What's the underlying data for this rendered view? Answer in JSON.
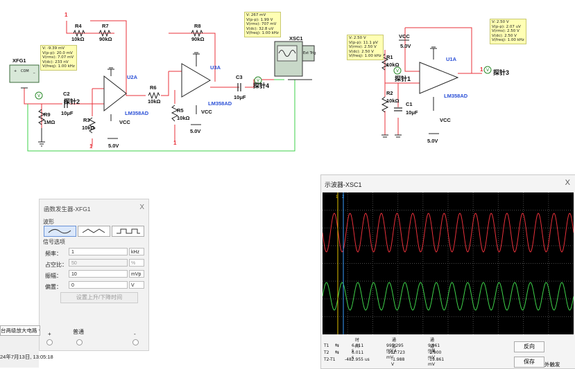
{
  "schematic": {
    "xfg1": "XFG1",
    "xsc1": "XSC1",
    "ext_trig": "Ext Trig",
    "plus": "+",
    "minus": "_",
    "com": "COM",
    "parts": {
      "r4": "R4",
      "r4v": "10kΩ",
      "r7": "R7",
      "r7v": "90kΩ",
      "r8": "R8",
      "r8v": "90kΩ",
      "r6": "R6",
      "r6v": "10kΩ",
      "r3": "R3",
      "r3v": "10kΩ",
      "r5": "R5",
      "r5v": "10kΩ",
      "r9": "R9",
      "r9v": "1MΩ",
      "r1": "R1",
      "r1v": "10kΩ",
      "r2": "R2",
      "r2v": "10kΩ",
      "c1": "C1",
      "c1v": "10μF",
      "c2": "C2",
      "c2v": "10μF",
      "c3": "C3",
      "c3v": "10μF",
      "u2a": "U2A",
      "u3a": "U3A",
      "u1a": "U1A",
      "lm": "LM358AD",
      "vcc": "VCC",
      "v50": "5.0V",
      "probe1": "探针1",
      "probe2": "探针2",
      "probe3": "探针3",
      "probe4": "探针4",
      "one": "1",
      "v": "V"
    },
    "probe2_readout": [
      "V: -9.39 mV",
      "V(p-p): 20.0 mV",
      "V(rms): 7.07 mV",
      "V(dc): 233 nV",
      "V(freq): 1.00 kHz"
    ],
    "probe4_readout": [
      "V: 267 mV",
      "V(p-p): 1.99 V",
      "V(rms): 707 mV",
      "V(dc): 32.8 uV",
      "V(freq): 1.00 kHz"
    ],
    "probe1_readout": [
      "V: 2.50 V",
      "V(p-p): 11.1 pV",
      "V(rms): 2.50 V",
      "V(dc): 2.50 V",
      "V(freq): 1.00 kHz"
    ],
    "probe3_readout": [
      "V: 2.50 V",
      "V(p-p): 2.07 uV",
      "V(rms): 2.50 V",
      "V(dc): 2.50 V",
      "V(freq): 1.00 kHz"
    ]
  },
  "function_generator": {
    "title": "函数发生器-XFG1",
    "close": "X",
    "waveform_label": "波形",
    "signal_label": "信号选项",
    "fields": [
      {
        "label": "频率：",
        "value": "1",
        "unit": "kHz"
      },
      {
        "label": "占空比：",
        "value": "50",
        "unit": "%"
      },
      {
        "label": "振幅：",
        "value": "10",
        "unit": "mVp"
      },
      {
        "label": "偏置：",
        "value": "0",
        "unit": "V"
      }
    ],
    "rise_fall_button": "设置上升/下降时间",
    "plus": "+",
    "common": "普通",
    "minus": "-"
  },
  "oscilloscope": {
    "title": "示波器-XSC1",
    "close": "X",
    "col_time": "时间",
    "col_a": "通道_A",
    "col_b": "通道_B",
    "rows": [
      {
        "label": "T1",
        "time": "6.011 s",
        "a": "995.295 mV",
        "b": "9.961 mV"
      },
      {
        "label": "T2",
        "time": "6.011 s",
        "a": "-992.723 mV",
        "b": "-9.900 mV"
      },
      {
        "label": "T2-T1",
        "time": "-482.955 us",
        "a": "-1.988 V",
        "b": "-19.861 mV"
      }
    ],
    "reverse_button": "反向",
    "save_button": "保存",
    "ext_trigger": "外触发",
    "colors": {
      "channel_a": "#e8303a",
      "channel_b": "#3ed24a",
      "grid": "#4a4a4a"
    },
    "cycles_visible": 16,
    "cursor_t1": "1",
    "cursor_t2": "2"
  },
  "statusbar": {
    "tab": "台两级放大电路 *",
    "timestamp": "24年7月13日, 13:05:18"
  }
}
